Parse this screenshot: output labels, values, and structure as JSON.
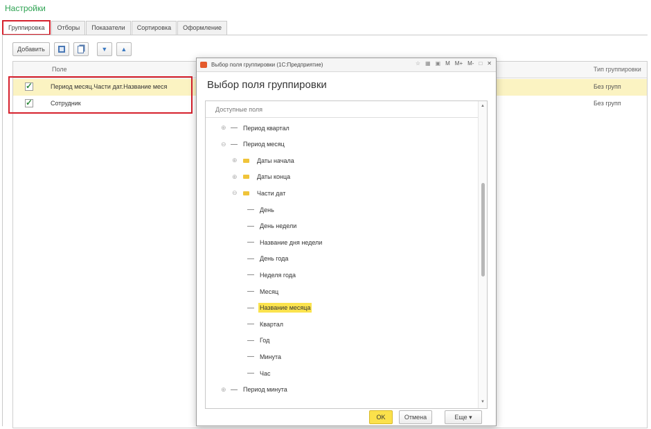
{
  "settings": {
    "title": "Настройки",
    "tabs": [
      "Группировка",
      "Отборы",
      "Показатели",
      "Сортировка",
      "Оформление"
    ],
    "toolbar": {
      "add_label": "Добавить"
    },
    "grid": {
      "columns": {
        "field": "Поле",
        "type": "Тип группировки"
      },
      "rows": [
        {
          "field": "Период месяц.Части дат.Название меся",
          "type": "Без групп",
          "checked": true,
          "selected": true
        },
        {
          "field": "Сотрудник",
          "type": "Без групп",
          "checked": true,
          "selected": false
        }
      ]
    }
  },
  "dialog": {
    "title": "Выбор поля группировки (1С:Предприятие)",
    "titlebar_buttons": [
      "M",
      "M+",
      "M-"
    ],
    "heading": "Выбор поля группировки",
    "tree_header": "Доступные поля",
    "nodes": [
      {
        "label": "Период квартал",
        "kind": "dash",
        "expander": "⊕"
      },
      {
        "label": "Период месяц",
        "kind": "dash",
        "expander": "⊖"
      },
      {
        "label": "Даты начала",
        "kind": "folder",
        "expander": "⊕"
      },
      {
        "label": "Даты конца",
        "kind": "folder",
        "expander": "⊕"
      },
      {
        "label": "Части дат",
        "kind": "folder",
        "expander": "⊖"
      },
      {
        "label": "День",
        "kind": "dash"
      },
      {
        "label": "День недели",
        "kind": "dash"
      },
      {
        "label": "Название дня недели",
        "kind": "dash"
      },
      {
        "label": "День года",
        "kind": "dash"
      },
      {
        "label": "Неделя года",
        "kind": "dash"
      },
      {
        "label": "Месяц",
        "kind": "dash"
      },
      {
        "label": "Название месяца",
        "kind": "dash",
        "highlighted": true
      },
      {
        "label": "Квартал",
        "kind": "dash"
      },
      {
        "label": "Год",
        "kind": "dash"
      },
      {
        "label": "Минута",
        "kind": "dash"
      },
      {
        "label": "Час",
        "kind": "dash"
      },
      {
        "label": "Период минута",
        "kind": "dash",
        "expander": "⊕"
      }
    ],
    "buttons": {
      "ok": "OK",
      "cancel": "Отмена",
      "more": "Еще ▾"
    }
  },
  "colors": {
    "accent": "#2aa14f",
    "highlight": "#fbe34e",
    "annotation": "#d6202c"
  }
}
